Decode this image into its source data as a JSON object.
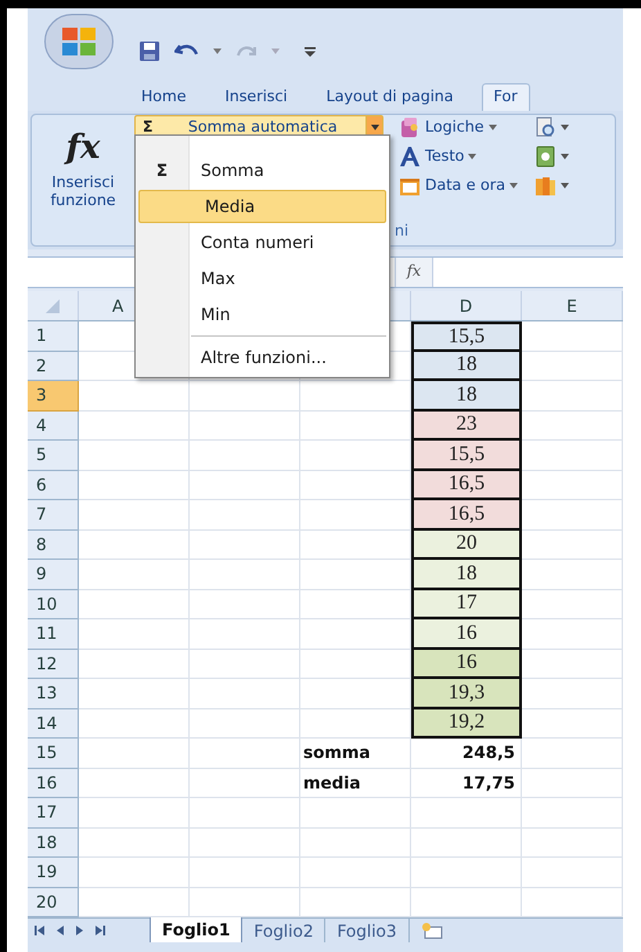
{
  "tabs": [
    {
      "label": "Home",
      "selected": false
    },
    {
      "label": "Inserisci",
      "selected": false
    },
    {
      "label": "Layout di pagina",
      "selected": false
    },
    {
      "label": "For",
      "selected": true
    }
  ],
  "ribbon": {
    "insert_function": {
      "symbol": "fx",
      "label": "Inserisci funzione"
    },
    "autosum": {
      "symbol": "Σ",
      "label": "Somma automatica",
      "open": true
    },
    "function_buttons": [
      {
        "label": "Logiche"
      },
      {
        "label": "Testo"
      },
      {
        "label": "Data e ora"
      }
    ],
    "group_label": "ni"
  },
  "autosum_menu": {
    "items": [
      {
        "label": "Somma",
        "symbol": "Σ",
        "selected": false,
        "separator_before": false
      },
      {
        "label": "Media",
        "selected": true,
        "separator_before": false
      },
      {
        "label": "Conta numeri",
        "selected": false,
        "separator_before": false
      },
      {
        "label": "Max",
        "selected": false,
        "separator_before": false
      },
      {
        "label": "Min",
        "selected": false,
        "separator_before": false
      },
      {
        "label": "Altre funzioni...",
        "selected": false,
        "separator_before": true
      }
    ]
  },
  "formula_bar": {
    "symbol": "fx"
  },
  "columns": [
    {
      "label": "A"
    },
    {
      "label": "D"
    },
    {
      "label": "E"
    }
  ],
  "rows": [
    {
      "number": "1",
      "selected": false,
      "kind": "data",
      "value": "15,5",
      "color": "#dce6f1"
    },
    {
      "number": "2",
      "selected": false,
      "kind": "data",
      "value": "18",
      "color": "#dce6f1"
    },
    {
      "number": "3",
      "selected": true,
      "kind": "data",
      "value": "18",
      "color": "#dce6f1"
    },
    {
      "number": "4",
      "selected": false,
      "kind": "data",
      "value": "23",
      "color": "#f2dcdb"
    },
    {
      "number": "5",
      "selected": false,
      "kind": "data",
      "value": "15,5",
      "color": "#f2dcdb"
    },
    {
      "number": "6",
      "selected": false,
      "kind": "data",
      "value": "16,5",
      "color": "#f2dcdb"
    },
    {
      "number": "7",
      "selected": false,
      "kind": "data",
      "value": "16,5",
      "color": "#f2dcdb"
    },
    {
      "number": "8",
      "selected": false,
      "kind": "data",
      "value": "20",
      "color": "#ebf1de"
    },
    {
      "number": "9",
      "selected": false,
      "kind": "data",
      "value": "18",
      "color": "#ebf1de"
    },
    {
      "number": "10",
      "selected": false,
      "kind": "data",
      "value": "17",
      "color": "#ebf1de"
    },
    {
      "number": "11",
      "selected": false,
      "kind": "data",
      "value": "16",
      "color": "#ebf1de"
    },
    {
      "number": "12",
      "selected": false,
      "kind": "data",
      "value": "16",
      "color": "#d8e4bc"
    },
    {
      "number": "13",
      "selected": false,
      "kind": "data",
      "value": "19,3",
      "color": "#d8e4bc"
    },
    {
      "number": "14",
      "selected": false,
      "kind": "data",
      "value": "19,2",
      "color": "#d8e4bc"
    },
    {
      "number": "15",
      "selected": false,
      "kind": "total",
      "label": "somma",
      "value": "248,5"
    },
    {
      "number": "16",
      "selected": false,
      "kind": "total",
      "label": "media",
      "value": "17,75"
    },
    {
      "number": "17",
      "selected": false,
      "kind": "empty"
    },
    {
      "number": "18",
      "selected": false,
      "kind": "empty"
    },
    {
      "number": "19",
      "selected": false,
      "kind": "empty"
    },
    {
      "number": "20",
      "selected": false,
      "kind": "empty"
    }
  ],
  "sheet_tabs": [
    {
      "label": "Foglio1",
      "selected": true
    },
    {
      "label": "Foglio2",
      "selected": false
    },
    {
      "label": "Foglio3",
      "selected": false
    }
  ]
}
